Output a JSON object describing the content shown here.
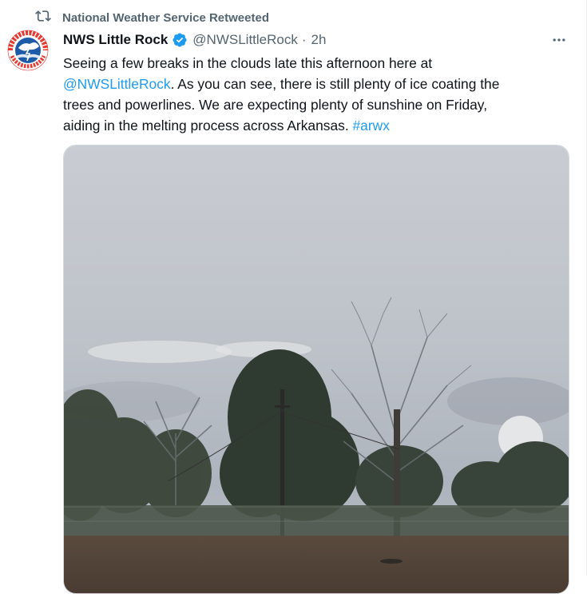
{
  "social_context": {
    "label": "National Weather Service Retweeted"
  },
  "author": {
    "display_name": "NWS Little Rock",
    "handle": "@NWSLittleRock",
    "time": "2h",
    "separator": "·",
    "avatar_text": "NATIONAL WEATHER SERVICE"
  },
  "tweet": {
    "line1": "Seeing a few breaks in the clouds late this afternoon here at",
    "mention": "@NWSLittleRock",
    "line2_rest": ". As you can see, there is still plenty of ice coating the",
    "line3": "trees and powerlines. We are expecting plenty of sunshine on Friday,",
    "line4": "aiding in the melting process across Arkansas. ",
    "hashtag": "#arwx"
  },
  "icons": {
    "retweet": "retweet-icon",
    "verified": "verified-badge-icon",
    "more": "more-options-icon"
  },
  "colors": {
    "link": "#1d9bf0",
    "muted": "#536471",
    "verified": "#1d9bf0",
    "nws_red": "#e1251b",
    "nws_blue": "#1d5aa8"
  }
}
